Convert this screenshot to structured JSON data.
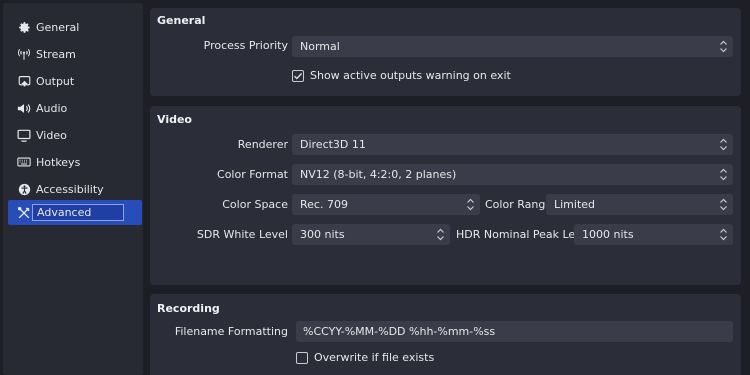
{
  "sidebar": {
    "items": [
      {
        "label": "General",
        "icon": "gear-icon"
      },
      {
        "label": "Stream",
        "icon": "antenna-icon"
      },
      {
        "label": "Output",
        "icon": "output-icon"
      },
      {
        "label": "Audio",
        "icon": "speaker-icon"
      },
      {
        "label": "Video",
        "icon": "monitor-icon"
      },
      {
        "label": "Hotkeys",
        "icon": "keyboard-icon"
      },
      {
        "label": "Accessibility",
        "icon": "accessibility-icon"
      },
      {
        "label": "Advanced",
        "icon": "tools-icon",
        "active": true
      }
    ]
  },
  "general": {
    "title": "General",
    "process_priority_label": "Process Priority",
    "process_priority_value": "Normal",
    "show_warning_label": "Show active outputs warning on exit",
    "show_warning_checked": true
  },
  "video": {
    "title": "Video",
    "renderer_label": "Renderer",
    "renderer_value": "Direct3D 11",
    "color_format_label": "Color Format",
    "color_format_value": "NV12 (8-bit, 4:2:0, 2 planes)",
    "color_space_label": "Color Space",
    "color_space_value": "Rec. 709",
    "color_range_label": "Color Range",
    "color_range_value": "Limited",
    "sdr_white_label": "SDR White Level",
    "sdr_white_value": "300 nits",
    "hdr_peak_label": "HDR Nominal Peak Level",
    "hdr_peak_value": "1000 nits"
  },
  "recording": {
    "title": "Recording",
    "filename_label": "Filename Formatting",
    "filename_value": "%CCYY-%MM-%DD %hh-%mm-%ss",
    "overwrite_label": "Overwrite if file exists",
    "overwrite_checked": false
  },
  "colors": {
    "background": "#1e1f26",
    "panel": "#2b2e38",
    "field": "#3a3d49",
    "accent": "#284cb8"
  }
}
